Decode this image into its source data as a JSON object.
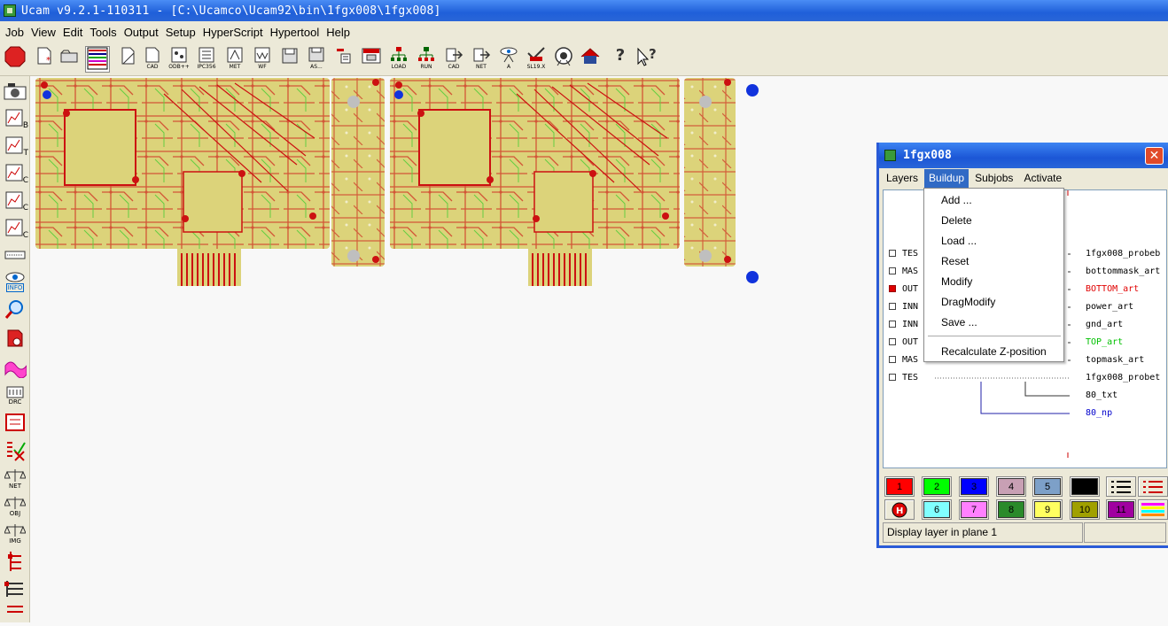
{
  "window": {
    "title": "Ucam v9.2.1-110311 - [C:\\Ucamco\\Ucam92\\bin\\1fgx008\\1fgx008]"
  },
  "menubar": [
    "Job",
    "View",
    "Edit",
    "Tools",
    "Output",
    "Setup",
    "HyperScript",
    "Hypertool",
    "Help"
  ],
  "toolbar": {
    "buttons": [
      {
        "icon": "stop-icon",
        "label": ""
      },
      {
        "icon": "new-job-icon",
        "label": ""
      },
      {
        "icon": "open-folder-icon",
        "label": ""
      },
      {
        "icon": "layer-table-icon",
        "label": ""
      },
      {
        "icon": "cad-import-icon",
        "label": "CAD"
      },
      {
        "icon": "odb-import-icon",
        "label": "ODB++"
      },
      {
        "icon": "ipc356-import-icon",
        "label": "IPC356"
      },
      {
        "icon": "met-import-icon",
        "label": "MET"
      },
      {
        "icon": "wf-import-icon",
        "label": "WF"
      },
      {
        "icon": "save-icon",
        "label": ""
      },
      {
        "icon": "save-as-icon",
        "label": "AS..."
      },
      {
        "icon": "print-icon",
        "label": ""
      },
      {
        "icon": "print-preview-icon",
        "label": ""
      },
      {
        "icon": "load-net-icon",
        "label": "LOAD"
      },
      {
        "icon": "run-net-icon",
        "label": "RUN"
      },
      {
        "icon": "cad-export-icon",
        "label": "CAD"
      },
      {
        "icon": "net-export-icon",
        "label": "NET"
      },
      {
        "icon": "antenna-icon",
        "label": "A"
      },
      {
        "icon": "sl19x-icon",
        "label": "SL19.X"
      },
      {
        "icon": "camera-eye-icon",
        "label": ""
      },
      {
        "icon": "home-icon",
        "label": ""
      },
      {
        "icon": "help-icon",
        "label": "?"
      },
      {
        "icon": "context-help-icon",
        "label": "?"
      }
    ]
  },
  "sidebar": {
    "items": [
      {
        "icon": "camera-icon",
        "label": ""
      },
      {
        "icon": "chart-b-icon",
        "label": "B"
      },
      {
        "icon": "chart-t-icon",
        "label": "T"
      },
      {
        "icon": "chart-jc-icon",
        "label": "C"
      },
      {
        "icon": "chart-lc-icon",
        "label": "C"
      },
      {
        "icon": "chart-ic-icon",
        "label": "C"
      },
      {
        "icon": "dotted-bar-icon",
        "label": ""
      },
      {
        "icon": "eye-info-icon",
        "label": "INFO"
      },
      {
        "icon": "magnifier-icon",
        "label": ""
      },
      {
        "icon": "red-chip-icon",
        "label": ""
      },
      {
        "icon": "pink-wave-icon",
        "label": ""
      },
      {
        "icon": "drc-icon",
        "label": "DRC"
      },
      {
        "icon": "red-frame-icon",
        "label": ""
      },
      {
        "icon": "check-cross-icon",
        "label": ""
      },
      {
        "icon": "scale-net-icon",
        "label": "NET"
      },
      {
        "icon": "scale-obj-icon",
        "label": "OBJ"
      },
      {
        "icon": "scale-img-icon",
        "label": "IMG"
      },
      {
        "icon": "red-tree-icon",
        "label": ""
      },
      {
        "icon": "list-icon",
        "label": ""
      },
      {
        "icon": "red-list-icon",
        "label": ""
      }
    ]
  },
  "dialog": {
    "title": "1fgx008",
    "close_label": "✕",
    "tabs": [
      {
        "label": "Layers",
        "active": false
      },
      {
        "label": "Buildup",
        "active": true
      },
      {
        "label": "Subjobs",
        "active": false
      },
      {
        "label": "Activate",
        "active": false
      }
    ],
    "layer_rows": [
      {
        "code": "TES",
        "checked": false,
        "name": "1fgx008_probeb",
        "color": "#000000"
      },
      {
        "code": "MAS",
        "checked": false,
        "name": "bottommask_art",
        "color": "#000000"
      },
      {
        "code": "OUT",
        "checked": true,
        "name": "BOTTOM_art",
        "color": "#e00000"
      },
      {
        "code": "INN",
        "checked": false,
        "name": "power_art",
        "color": "#000000"
      },
      {
        "code": "INN",
        "checked": false,
        "name": "gnd_art",
        "color": "#000000"
      },
      {
        "code": "OUT",
        "checked": false,
        "name": "TOP_art",
        "color": "#00c000"
      },
      {
        "code": "MAS",
        "checked": false,
        "name": "topmask_art",
        "color": "#000000"
      },
      {
        "code": "TES",
        "checked": false,
        "name": "1fgx008_probet",
        "color": "#000000"
      }
    ],
    "extra_layers": [
      {
        "name": "80_txt",
        "color": "#000000"
      },
      {
        "name": "80_np",
        "color": "#0000cc"
      }
    ],
    "swatches_row1": [
      {
        "label": "1",
        "color": "#ff0000",
        "text_color": "#000000"
      },
      {
        "label": "2",
        "color": "#00ff00",
        "text_color": "#000000"
      },
      {
        "label": "3",
        "color": "#0000ff",
        "text_color": "#000000"
      },
      {
        "label": "4",
        "color": "#c8a0b4",
        "text_color": "#000000"
      },
      {
        "label": "5",
        "color": "#7da0c8",
        "text_color": "#000000"
      },
      {
        "label": "",
        "color": "#000000",
        "text_color": "#ffffff"
      }
    ],
    "swatches_row2": [
      {
        "label": "6",
        "color": "#80ffff",
        "text_color": "#000000"
      },
      {
        "label": "7",
        "color": "#ff80ff",
        "text_color": "#000000"
      },
      {
        "label": "8",
        "color": "#2a8a2a",
        "text_color": "#000000"
      },
      {
        "label": "9",
        "color": "#ffff60",
        "text_color": "#000000"
      },
      {
        "label": "10",
        "color": "#a0a000",
        "text_color": "#000000"
      },
      {
        "label": "11",
        "color": "#a000a0",
        "text_color": "#000000"
      }
    ],
    "status": "Display layer in plane 1"
  },
  "dropdown": {
    "items": [
      "Add ...",
      "Delete",
      "Load ...",
      "Reset",
      "Modify",
      "DragModify",
      "Save ..."
    ],
    "last_item": "Recalculate Z-position"
  },
  "colors": {
    "board": "#dcd37a",
    "trace_red": "#cc1111",
    "trace_green": "#22cc22",
    "fiducial_blue": "#1133dd",
    "selection_blue": "#316ac5"
  }
}
